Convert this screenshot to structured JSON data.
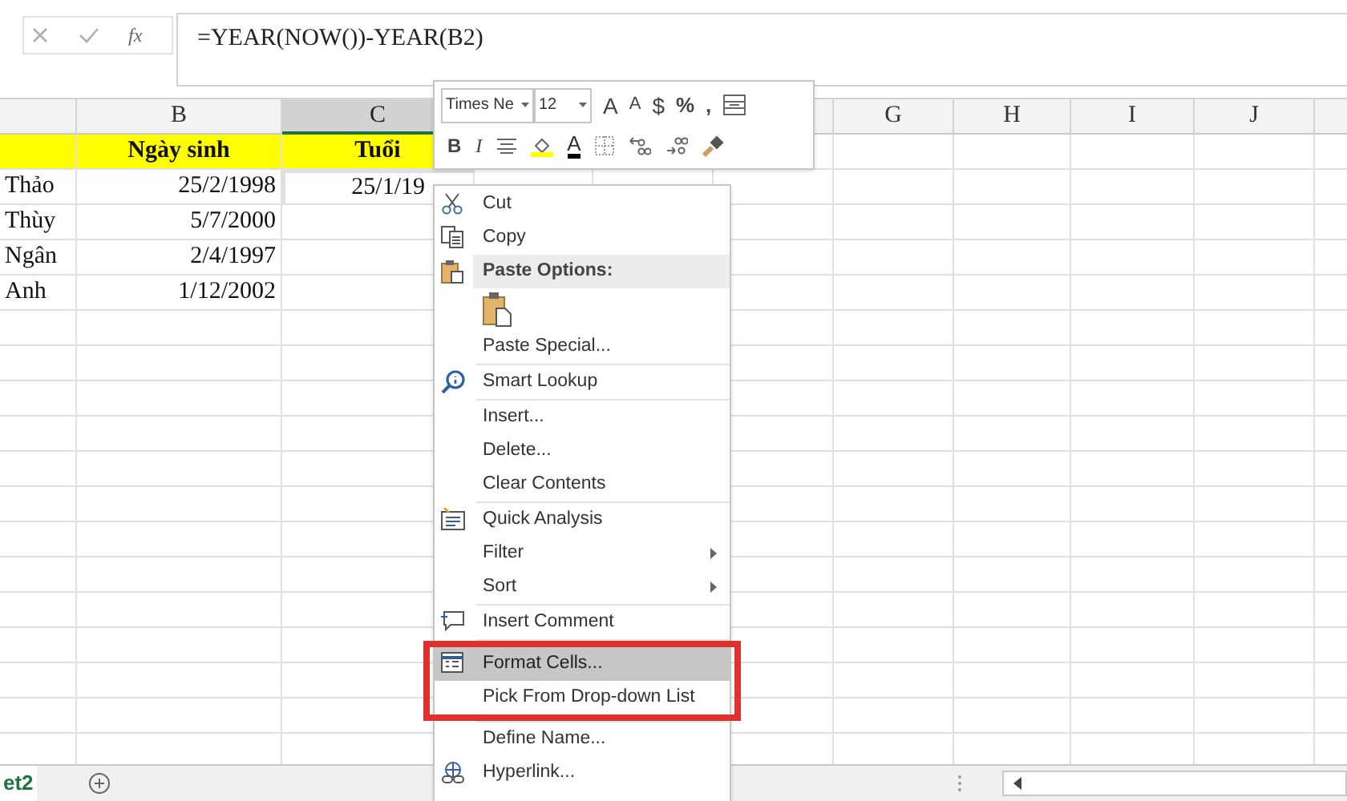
{
  "formula_bar": {
    "function_label": "fx",
    "formula": "=YEAR(NOW())-YEAR(B2)"
  },
  "columns": [
    {
      "selected": false
    },
    {
      "label": "B",
      "selected": false
    },
    {
      "label": "C",
      "selected": true
    },
    {
      "selected": false
    },
    {
      "label": "G",
      "selected": false
    },
    {
      "label": "H",
      "selected": false
    },
    {
      "label": "I",
      "selected": false
    },
    {
      "label": "J",
      "selected": false
    },
    {
      "selected": false
    }
  ],
  "header_row": {
    "column_b": "Ngày sinh",
    "column_c": "Tuổi"
  },
  "rows": [
    {
      "column_a": "Thảo",
      "column_b": "25/2/1998",
      "column_c": "25/1/19",
      "active": true
    },
    {
      "column_a": "Thùy",
      "column_b": "5/7/2000",
      "active": false
    },
    {
      "column_a": "Ngân",
      "column_b": "2/4/1997",
      "active": false
    },
    {
      "column_a": "Anh",
      "column_b": "1/12/2002",
      "active": false
    }
  ],
  "mini_toolbar": {
    "font": "Times Ne",
    "size": "12",
    "row_1": [
      {
        "kind": "grow",
        "text": "A"
      },
      {
        "kind": "shrink",
        "text": "A"
      },
      {
        "kind": "dropdown",
        "text": "$"
      },
      {
        "kind": "plain",
        "text": "%"
      },
      {
        "kind": "plain",
        "text": ","
      },
      {
        "kind": "format_icon"
      }
    ],
    "row_2": [
      {
        "kind": "bold",
        "text": "B"
      },
      {
        "kind": "italic",
        "text": "I"
      },
      {
        "kind": "align_icon"
      },
      {
        "kind": "fill_icon"
      },
      {
        "kind": "font_color",
        "text": "A"
      },
      {
        "kind": "border_icon"
      },
      {
        "kind": "more_decimals_icon"
      },
      {
        "kind": "fewer_decimals_icon"
      },
      {
        "kind": "painter_icon"
      }
    ]
  },
  "context_menu": [
    {
      "kind": "scissors",
      "label": "Cut",
      "selected": false,
      "highlighted": false
    },
    {
      "kind": "copy",
      "label": "Copy",
      "selected": false,
      "highlighted": false
    },
    {
      "kind": "header",
      "label": "Paste Options:"
    },
    {
      "kind": "paste"
    },
    {
      "kind": "plain",
      "label": "Paste Special...",
      "selected": false,
      "highlighted": false
    },
    {
      "kind": "separator"
    },
    {
      "kind": "lookup",
      "label": "Smart Lookup",
      "selected": false,
      "highlighted": false
    },
    {
      "kind": "separator"
    },
    {
      "kind": "plain",
      "label": "Insert...",
      "selected": false,
      "highlighted": false
    },
    {
      "kind": "plain",
      "label": "Delete...",
      "selected": false,
      "highlighted": false
    },
    {
      "kind": "plain",
      "label": "Clear Contents",
      "selected": false,
      "highlighted": false
    },
    {
      "kind": "separator"
    },
    {
      "kind": "analysis",
      "label": "Quick Analysis",
      "selected": false,
      "highlighted": false
    },
    {
      "kind": "submenu",
      "label": "Filter",
      "selected": false,
      "highlighted": false
    },
    {
      "kind": "submenu",
      "label": "Sort",
      "selected": false,
      "highlighted": false
    },
    {
      "kind": "separator"
    },
    {
      "kind": "comment",
      "label": "Insert Comment",
      "selected": false,
      "highlighted": false
    },
    {
      "kind": "separator"
    },
    {
      "kind": "format",
      "label": "Format Cells...",
      "selected": true,
      "highlighted": true
    },
    {
      "kind": "plain",
      "label": "Pick From Drop-down List",
      "selected": false,
      "highlighted": true
    },
    {
      "kind": "separator"
    },
    {
      "kind": "plain",
      "label": "Define Name...",
      "selected": false,
      "highlighted": false
    },
    {
      "kind": "link",
      "label": "Hyperlink...",
      "selected": false,
      "highlighted": false
    }
  ],
  "sheet_tabs": [
    {
      "label": "et2",
      "selected": true
    }
  ]
}
